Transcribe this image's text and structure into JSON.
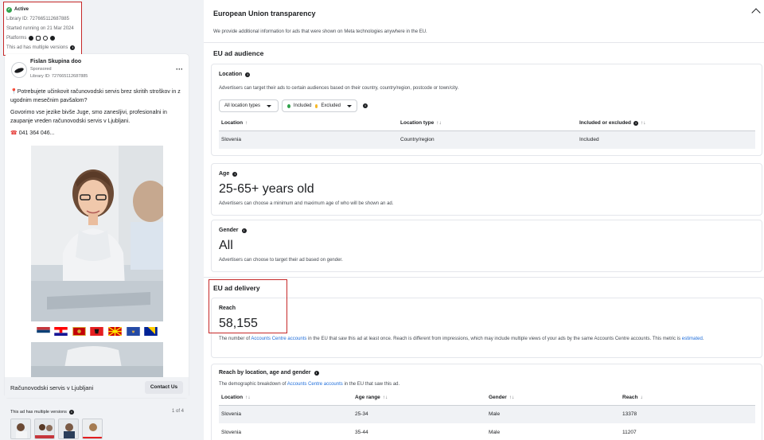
{
  "ad_meta": {
    "status": "Active",
    "library_id": "Library ID: 727665112687885",
    "started": "Started running on 21 Mar 2024",
    "platforms_label": "Platforms",
    "multiple_versions": "This ad has multiple versions"
  },
  "ad": {
    "page_name": "Fislan Skupina doo",
    "sponsored": "Sponsored",
    "library_id": "Library ID: 727665112687885",
    "body_line1": "Potrebujete učinkovit računovodski servis brez skritih stroškov in z ugodnim mesečnim pavšalom?",
    "body_line2": "Govorimo vse jezike bivše Juge, smo zanesljivi, profesionalni in zaupanje vreden računovodski servis v Ljubljani.",
    "phone": "041 364 046...",
    "footer_title": "Računovodski servis v Ljubljani",
    "cta": "Contact Us"
  },
  "versions": {
    "label": "This ad has multiple versions",
    "page": "1 of 4"
  },
  "transparency": {
    "title": "European Union transparency",
    "intro": "We provide additional information for ads that were shown on Meta technologies anywhere in the EU."
  },
  "audience": {
    "title": "EU ad audience",
    "location": {
      "title": "Location",
      "desc": "Advertisers can target their ads to certain audiences based on their country, country/region, postcode or town/city.",
      "filter_label": "All location types",
      "included_label": "Included",
      "excluded_label": "Excluded",
      "headers": [
        "Location",
        "Location type",
        "Included or excluded"
      ],
      "rows": [
        [
          "Slovenia",
          "Country/region",
          "Included"
        ]
      ]
    },
    "age": {
      "title": "Age",
      "value": "25-65+ years old",
      "desc": "Advertisers can choose a minimum and maximum age of who will be shown an ad."
    },
    "gender": {
      "title": "Gender",
      "value": "All",
      "desc": "Advertisers can choose to target their ad based on gender."
    }
  },
  "delivery": {
    "title": "EU ad delivery",
    "reach_label": "Reach",
    "reach_value": "58,155",
    "reach_desc_1": "The number of",
    "reach_desc_link": "Accounts Centre accounts",
    "reach_desc_2": "in the EU that saw this ad at least once. Reach is different from impressions, which may include multiple views of your ads by the same Accounts Centre accounts. This metric is",
    "reach_desc_link2": "estimated",
    "breakdown_title": "Reach by location, age and gender",
    "breakdown_desc_1": "The demographic breakdown of",
    "breakdown_desc_link": "Accounts Centre accounts",
    "breakdown_desc_2": "in the EU that saw this ad.",
    "headers": [
      "Location",
      "Age range",
      "Gender",
      "Reach"
    ],
    "rows": [
      [
        "Slovenia",
        "25-34",
        "Male",
        "13378"
      ],
      [
        "Slovenia",
        "35-44",
        "Male",
        "11207"
      ]
    ]
  },
  "colors": {
    "accent_red": "#c62828",
    "link_blue": "#216fdb",
    "active_green": "#31a24c"
  }
}
